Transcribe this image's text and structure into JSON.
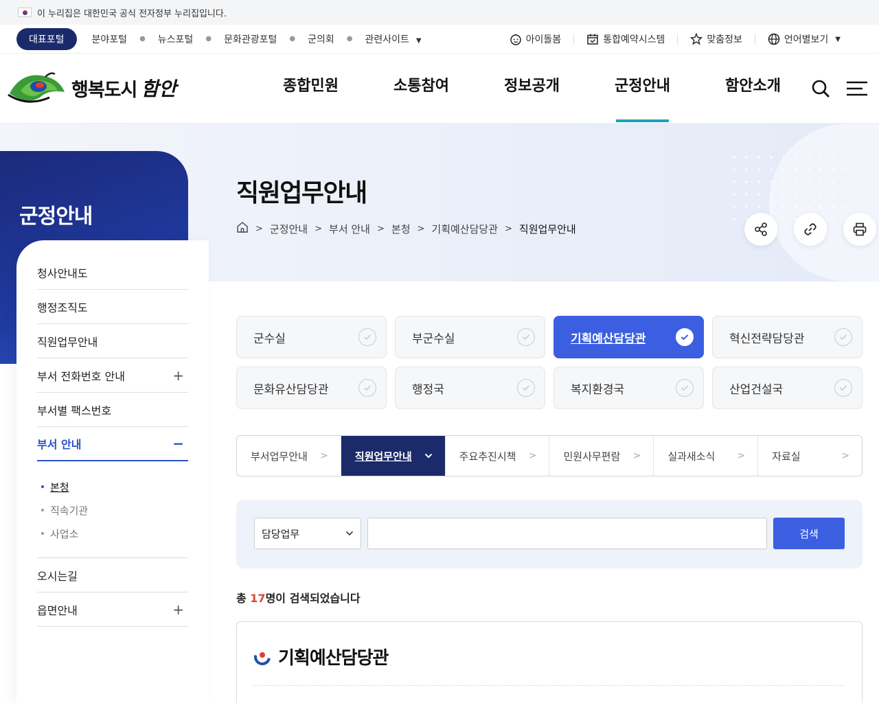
{
  "gov_banner": {
    "text": "이 누리집은 대한민국 공식 전자정부 누리집입니다."
  },
  "util_bar": {
    "main_portal": "대표포털",
    "links": [
      "분야포털",
      "뉴스포털",
      "문화관광포털",
      "군의회",
      "관련사이트"
    ],
    "right": [
      {
        "label": "아이돌봄",
        "icon": "baby-face-icon"
      },
      {
        "label": "통합예약시스템",
        "icon": "calendar-check-icon"
      },
      {
        "label": "맞춤정보",
        "icon": "star-person-icon"
      },
      {
        "label": "언어별보기",
        "icon": "globe-icon"
      }
    ]
  },
  "header": {
    "logo_text": "행복도시",
    "logo_script": "함안",
    "gnb": [
      "종합민원",
      "소통참여",
      "정보공개",
      "군정안내",
      "함안소개"
    ],
    "active_gnb": 3
  },
  "lnb": {
    "title": "군정안내",
    "items": [
      {
        "label": "청사안내도",
        "sign": ""
      },
      {
        "label": "행정조직도",
        "sign": ""
      },
      {
        "label": "직원업무안내",
        "sign": ""
      },
      {
        "label": "부서 전화번호 안내",
        "sign": "+"
      },
      {
        "label": "부서별 팩스번호",
        "sign": ""
      },
      {
        "label": "부서 안내",
        "sign": "−"
      }
    ],
    "sub_items": [
      "본청",
      "직속기관",
      "사업소"
    ],
    "bottom_items": [
      {
        "label": "오시는길",
        "sign": ""
      },
      {
        "label": "읍면안내",
        "sign": "+"
      }
    ]
  },
  "page": {
    "title": "직원업무안내",
    "breadcrumb": [
      "군정안내",
      "부서 안내",
      "본청",
      "기획예산담당관",
      "직원업무안내"
    ]
  },
  "departments": [
    "군수실",
    "부군수실",
    "기획예산담당관",
    "혁신전략담당관",
    "문화유산담당관",
    "행정국",
    "복지환경국",
    "산업건설국"
  ],
  "active_department": 2,
  "subtabs": [
    "부서업무안내",
    "직원업무안내",
    "주요추진시책",
    "민원사무편람",
    "실과새소식",
    "자료실"
  ],
  "active_subtab": 1,
  "search": {
    "select_value": "담당업무",
    "input_value": "",
    "button": "검색"
  },
  "result": {
    "prefix": "총 ",
    "count": "17",
    "suffix": "명이 검색되었습니다",
    "card_title": "기획예산담당관"
  },
  "colors": {
    "navy": "#1b2a6b",
    "accent": "#3b5fe0",
    "teal": "#1aa3b8",
    "count_red": "#e0432f"
  }
}
